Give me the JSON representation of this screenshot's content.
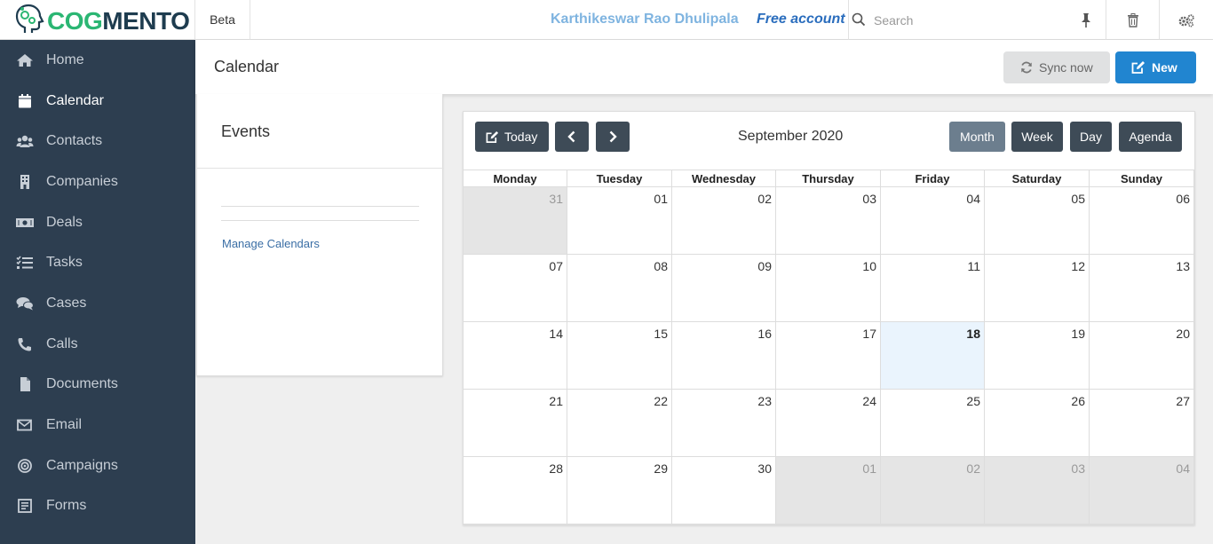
{
  "topbar": {
    "logo_part1": "COG",
    "logo_part2": "MENTO",
    "beta_label": "Beta",
    "user_name": "Karthikeswar Rao Dhulipala",
    "account_type": "Free account",
    "search_placeholder": "Search"
  },
  "sidebar": {
    "items": [
      {
        "label": "Home",
        "icon": "home-icon"
      },
      {
        "label": "Calendar",
        "icon": "calendar-icon",
        "active": true
      },
      {
        "label": "Contacts",
        "icon": "users-icon"
      },
      {
        "label": "Companies",
        "icon": "building-icon"
      },
      {
        "label": "Deals",
        "icon": "money-icon"
      },
      {
        "label": "Tasks",
        "icon": "tasks-icon"
      },
      {
        "label": "Cases",
        "icon": "comments-icon"
      },
      {
        "label": "Calls",
        "icon": "phone-icon"
      },
      {
        "label": "Documents",
        "icon": "file-icon"
      },
      {
        "label": "Email",
        "icon": "envelope-icon"
      },
      {
        "label": "Campaigns",
        "icon": "bullseye-icon"
      },
      {
        "label": "Forms",
        "icon": "form-icon"
      }
    ]
  },
  "header": {
    "title": "Calendar",
    "sync_label": "Sync now",
    "new_label": "New"
  },
  "events": {
    "title": "Events",
    "manage_link": "Manage Calendars"
  },
  "calendar": {
    "today_label": "Today",
    "month_title": "September 2020",
    "views": [
      "Month",
      "Week",
      "Day",
      "Agenda"
    ],
    "active_view": "Month",
    "weekdays": [
      "Monday",
      "Tuesday",
      "Wednesday",
      "Thursday",
      "Friday",
      "Saturday",
      "Sunday"
    ],
    "weeks": [
      [
        "31",
        "01",
        "02",
        "03",
        "04",
        "05",
        "06"
      ],
      [
        "07",
        "08",
        "09",
        "10",
        "11",
        "12",
        "13"
      ],
      [
        "14",
        "15",
        "16",
        "17",
        "18",
        "19",
        "20"
      ],
      [
        "21",
        "22",
        "23",
        "24",
        "25",
        "26",
        "27"
      ],
      [
        "28",
        "29",
        "30",
        "01",
        "02",
        "03",
        "04"
      ]
    ],
    "today": "18"
  },
  "colors": {
    "sidebar_bg": "#2d3e50",
    "primary_button": "#2185d0",
    "calendar_button": "#3e4b57",
    "active_view_button": "#6c7e8e",
    "today_cell": "#eaf4fd",
    "other_month_cell": "#e5e5e5",
    "logo_green": "#2bb673",
    "logo_dark": "#1e3c4f"
  }
}
